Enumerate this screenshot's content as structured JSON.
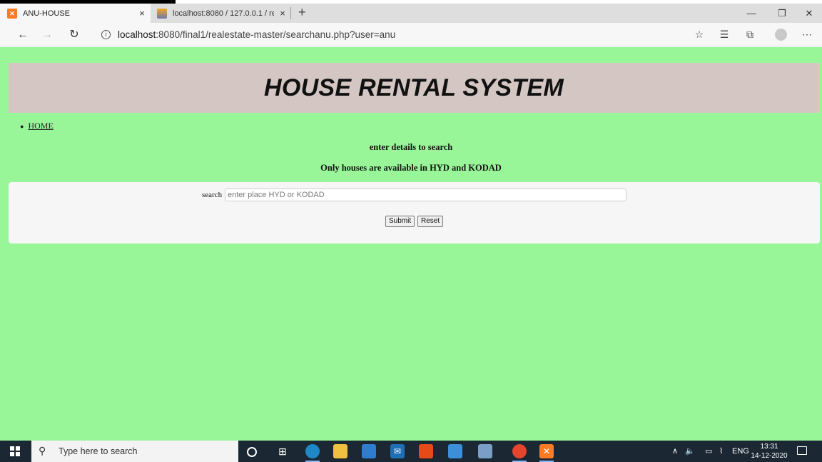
{
  "browser": {
    "tabs": [
      {
        "title": "ANU-HOUSE",
        "favicon": "xampp-icon",
        "active": true
      },
      {
        "title": "localhost:8080 / 127.0.0.1 / reale",
        "favicon": "phpmyadmin-icon",
        "active": false
      }
    ],
    "new_tab": "+",
    "close_glyph": "×",
    "url_host": "localhost",
    "url_path": ":8080/final1/realestate-master/searchanu.php?user=anu"
  },
  "page": {
    "banner_title": "HOUSE RENTAL SYSTEM",
    "nav": [
      {
        "label": "HOME"
      }
    ],
    "message1": "enter details to search",
    "message2": "Only houses are available in HYD and KODAD",
    "form": {
      "search_label": "search",
      "search_placeholder": "enter place HYD or KODAD",
      "submit_label": "Submit",
      "reset_label": "Reset"
    }
  },
  "taskbar": {
    "search_placeholder": "Type here to search",
    "language": "ENG",
    "time": "13:31",
    "date": "14-12-2020"
  },
  "colors": {
    "page_background": "#98f598",
    "banner_background": "#d3c6c3",
    "taskbar_background": "#1b2733"
  }
}
